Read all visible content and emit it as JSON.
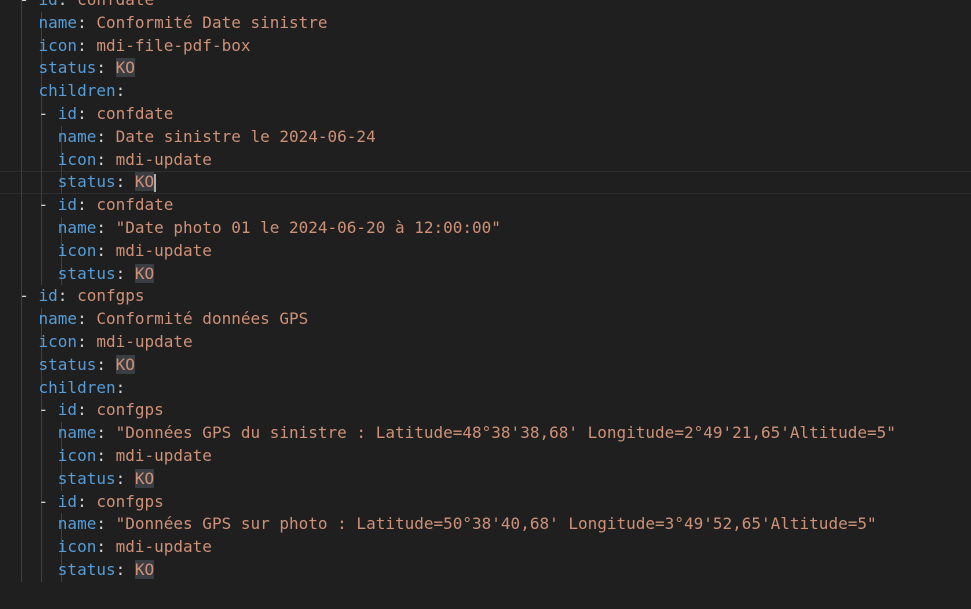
{
  "editor": {
    "lines": [
      {
        "indent": 2,
        "dash": true,
        "key": "id",
        "value": "confdate"
      },
      {
        "indent": 3,
        "dash": false,
        "key": "name",
        "value": "Conformité Date sinistre"
      },
      {
        "indent": 3,
        "dash": false,
        "key": "icon",
        "value": "mdi-file-pdf-box"
      },
      {
        "indent": 3,
        "dash": false,
        "key": "status",
        "value": "KO",
        "highlight": true
      },
      {
        "indent": 3,
        "dash": false,
        "key": "children",
        "value": ""
      },
      {
        "indent": 3,
        "dash": true,
        "key": "id",
        "value": "confdate"
      },
      {
        "indent": 4,
        "dash": false,
        "key": "name",
        "value": "Date sinistre le 2024-06-24"
      },
      {
        "indent": 4,
        "dash": false,
        "key": "icon",
        "value": "mdi-update"
      },
      {
        "indent": 4,
        "dash": false,
        "key": "status",
        "value": "KO",
        "highlight": true,
        "cursor": true
      },
      {
        "indent": 3,
        "dash": true,
        "key": "id",
        "value": "confdate"
      },
      {
        "indent": 4,
        "dash": false,
        "key": "name",
        "value": "\"Date photo 01 le 2024-06-20 à 12:00:00\""
      },
      {
        "indent": 4,
        "dash": false,
        "key": "icon",
        "value": "mdi-update"
      },
      {
        "indent": 4,
        "dash": false,
        "key": "status",
        "value": "KO",
        "highlight": true
      },
      {
        "indent": 2,
        "dash": true,
        "key": "id",
        "value": "confgps"
      },
      {
        "indent": 3,
        "dash": false,
        "key": "name",
        "value": "Conformité données GPS"
      },
      {
        "indent": 3,
        "dash": false,
        "key": "icon",
        "value": "mdi-update"
      },
      {
        "indent": 3,
        "dash": false,
        "key": "status",
        "value": "KO",
        "highlight": true
      },
      {
        "indent": 3,
        "dash": false,
        "key": "children",
        "value": ""
      },
      {
        "indent": 3,
        "dash": true,
        "key": "id",
        "value": "confgps"
      },
      {
        "indent": 4,
        "dash": false,
        "key": "name",
        "value": "\"Données GPS du sinistre : Latitude=48°38'38,68' Longitude=2°49'21,65'Altitude=5\""
      },
      {
        "indent": 4,
        "dash": false,
        "key": "icon",
        "value": "mdi-update"
      },
      {
        "indent": 4,
        "dash": false,
        "key": "status",
        "value": "KO",
        "highlight": true
      },
      {
        "indent": 3,
        "dash": true,
        "key": "id",
        "value": "confgps"
      },
      {
        "indent": 4,
        "dash": false,
        "key": "name",
        "value": "\"Données GPS sur photo : Latitude=50°38'40,68' Longitude=3°49'52,65'Altitude=5\""
      },
      {
        "indent": 4,
        "dash": false,
        "key": "icon",
        "value": "mdi-update"
      },
      {
        "indent": 4,
        "dash": false,
        "key": "status",
        "value": "KO",
        "highlight": true
      }
    ]
  },
  "colors": {
    "background": "#1f1f1f",
    "key": "#569cd6",
    "string": "#ce9178",
    "text": "#d4d4d4",
    "highlight": "#3a3d41",
    "indent_guide": "#404040"
  }
}
